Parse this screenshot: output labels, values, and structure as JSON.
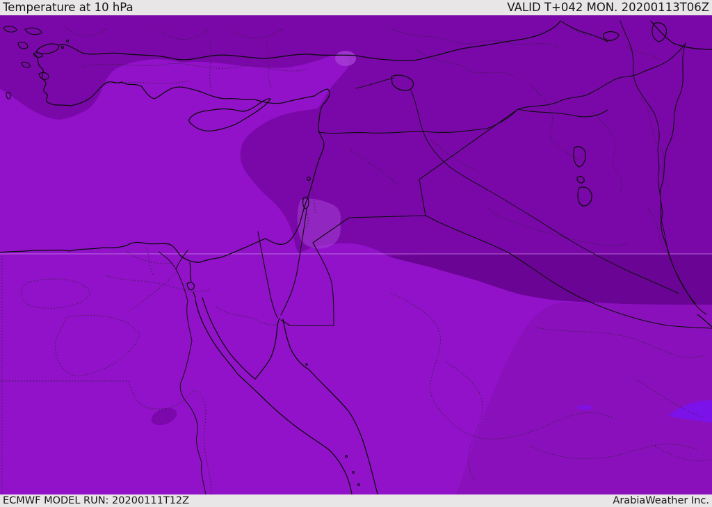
{
  "header": {
    "title": "Temperature at 10 hPa",
    "valid": "VALID T+042 MON. 20200113T06Z"
  },
  "footer": {
    "model_run": "ECMWF MODEL RUN: 20200111T12Z",
    "company": "ArabiaWeather Inc."
  },
  "map": {
    "description": "ECMWF temperature shading map of the Middle East at 10 hPa",
    "colors": {
      "bright": "#9212c9",
      "mid": "#8810ba",
      "dark": "#7a08a9",
      "darkest": "#6a0494",
      "lavender": "#a63fd6",
      "violet": "#7c12ea",
      "bar_bg": "#e8e6e7",
      "bar_text": "#161616"
    }
  }
}
